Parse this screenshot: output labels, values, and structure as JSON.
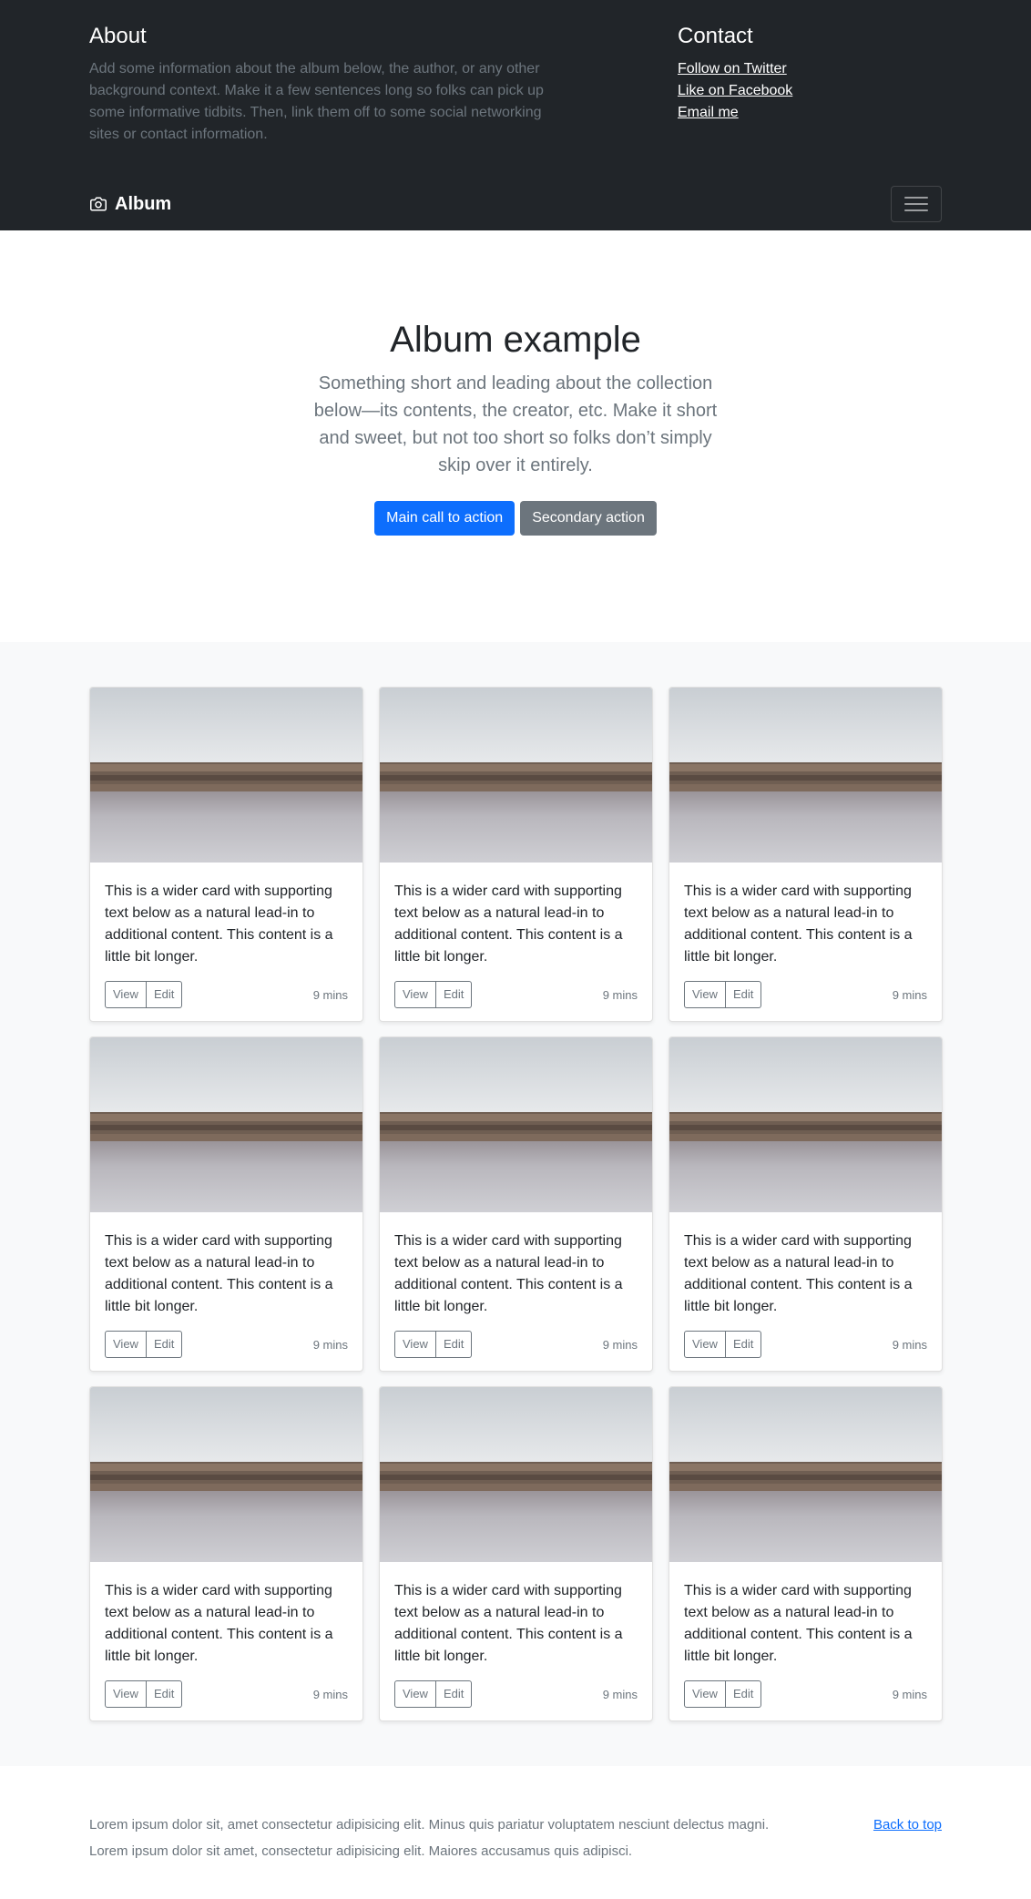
{
  "header": {
    "about_title": "About",
    "about_text": "Add some information about the album below, the author, or any other background context. Make it a few sentences long so folks can pick up some informative tidbits. Then, link them off to some social networking sites or contact information.",
    "contact_title": "Contact",
    "links": [
      "Follow on Twitter",
      "Like on Facebook",
      "Email me"
    ]
  },
  "navbar": {
    "brand": "Album",
    "brand_icon": "camera-icon",
    "toggler_icon": "hamburger-icon"
  },
  "hero": {
    "title": "Album example",
    "lead": "Something short and leading about the collection below—its contents, the creator, etc. Make it short and sweet, but not too short so folks don’t simply skip over it entirely.",
    "primary_label": "Main call to action",
    "secondary_label": "Secondary action"
  },
  "cards": [
    {
      "text": "This is a wider card with supporting text below as a natural lead-in to additional content. This content is a little bit longer.",
      "view": "View",
      "edit": "Edit",
      "time": "9 mins"
    },
    {
      "text": "This is a wider card with supporting text below as a natural lead-in to additional content. This content is a little bit longer.",
      "view": "View",
      "edit": "Edit",
      "time": "9 mins"
    },
    {
      "text": "This is a wider card with supporting text below as a natural lead-in to additional content. This content is a little bit longer.",
      "view": "View",
      "edit": "Edit",
      "time": "9 mins"
    },
    {
      "text": "This is a wider card with supporting text below as a natural lead-in to additional content. This content is a little bit longer.",
      "view": "View",
      "edit": "Edit",
      "time": "9 mins"
    },
    {
      "text": "This is a wider card with supporting text below as a natural lead-in to additional content. This content is a little bit longer.",
      "view": "View",
      "edit": "Edit",
      "time": "9 mins"
    },
    {
      "text": "This is a wider card with supporting text below as a natural lead-in to additional content. This content is a little bit longer.",
      "view": "View",
      "edit": "Edit",
      "time": "9 mins"
    },
    {
      "text": "This is a wider card with supporting text below as a natural lead-in to additional content. This content is a little bit longer.",
      "view": "View",
      "edit": "Edit",
      "time": "9 mins"
    },
    {
      "text": "This is a wider card with supporting text below as a natural lead-in to additional content. This content is a little bit longer.",
      "view": "View",
      "edit": "Edit",
      "time": "9 mins"
    },
    {
      "text": "This is a wider card with supporting text below as a natural lead-in to additional content. This content is a little bit longer.",
      "view": "View",
      "edit": "Edit",
      "time": "9 mins"
    }
  ],
  "footer": {
    "text_1": "Lorem ipsum dolor sit, amet consectetur adipisicing elit. Minus quis pariatur voluptatem nesciunt delectus magni.",
    "text_2": "Lorem ipsum dolor sit amet, consectetur adipisicing elit. Maiores accusamus quis adipisci.",
    "back_to_top": "Back to top"
  },
  "colors": {
    "dark": "#212529",
    "primary": "#0d6efd",
    "secondary": "#6c757d",
    "light": "#f8f9fa"
  }
}
